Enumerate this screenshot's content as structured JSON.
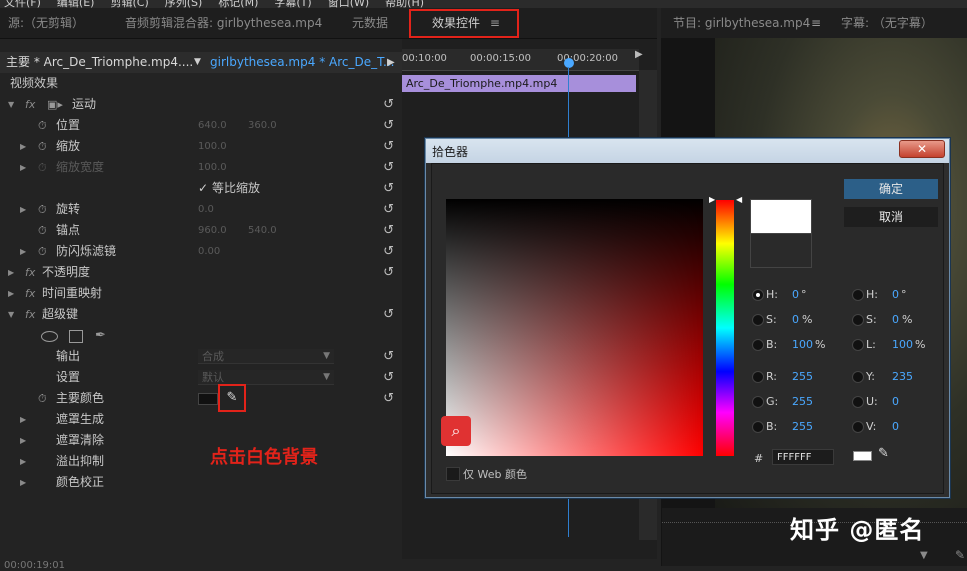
{
  "menubar": {
    "items": [
      "文件(F)",
      "编辑(E)",
      "剪辑(C)",
      "序列(S)",
      "标记(M)",
      "字幕(T)",
      "窗口(W)",
      "帮助(H)"
    ]
  },
  "tabs": {
    "source": "源:（无剪辑）",
    "audio_mixer": "音频剪辑混合器: girlbythesea.mp4",
    "metadata": "元数据",
    "effect_controls": "效果控件",
    "menu_glyph": "≡"
  },
  "right_tabs": {
    "program": "节目: girlbythesea.mp4",
    "captions": "字幕: （无字幕）"
  },
  "effects": {
    "master_label": "主要 * Arc_De_Triomphe.mp4....",
    "clip_label": "girlbythesea.mp4 * Arc_De_T...",
    "video_effects": "视频效果",
    "motion": "运动",
    "position": "位置",
    "position_x": "640.0",
    "position_y": "360.0",
    "scale": "缩放",
    "scale_val": "100.0",
    "scale_width": "缩放宽度",
    "scale_width_val": "100.0",
    "uniform_scale": "等比缩放",
    "rotation": "旋转",
    "rotation_val": "0.0",
    "anchor": "锚点",
    "anchor_x": "960.0",
    "anchor_y": "540.0",
    "flicker": "防闪烁滤镜",
    "flicker_val": "0.00",
    "opacity": "不透明度",
    "time_remap": "时间重映射",
    "ultra_key": "超级键",
    "output": "输出",
    "output_val": "合成",
    "setting": "设置",
    "setting_val": "默认",
    "key_color": "主要颜色",
    "matte_gen": "遮罩生成",
    "matte_cleanup": "遮罩清除",
    "spill": "溢出抑制",
    "color_correction": "颜色校正",
    "annotation": "点击白色背景",
    "timecode_bottom": "00:00:19:01"
  },
  "timeline": {
    "ruler": [
      "00:10:00",
      "00:00:15:00",
      "00:00:20:00"
    ],
    "clip": "Arc_De_Triomphe.mp4.mp4"
  },
  "color_picker": {
    "title": "拾色器",
    "ok": "确定",
    "cancel": "取消",
    "hsb": {
      "h_label": "H:",
      "h": "0",
      "h_unit": "°",
      "s_label": "S:",
      "s": "0",
      "s_unit": "%",
      "b_label": "B:",
      "b": "100",
      "b_unit": "%"
    },
    "rgb": {
      "r_label": "R:",
      "r": "255",
      "g_label": "G:",
      "g": "255",
      "b_label": "B:",
      "b": "255"
    },
    "hsl": {
      "h_label": "H:",
      "h": "0",
      "h_unit": "°",
      "s_label": "S:",
      "s": "0",
      "s_unit": "%",
      "l_label": "L:",
      "l": "100",
      "l_unit": "%"
    },
    "yuv": {
      "y_label": "Y:",
      "y": "235",
      "u_label": "U:",
      "u": "0",
      "v_label": "V:",
      "v": "0"
    },
    "hash": "#",
    "hex": "FFFFFF",
    "web_only": "仅 Web 颜色",
    "new_color": "#ffffff",
    "selected_color": "#ff0000"
  },
  "watermark": "知乎 @匿名",
  "colors": {
    "accent_blue": "#2c5f88",
    "highlight_red": "#e2231a",
    "link_blue": "#4aa8ff",
    "clip_purple": "#a78fdb"
  }
}
